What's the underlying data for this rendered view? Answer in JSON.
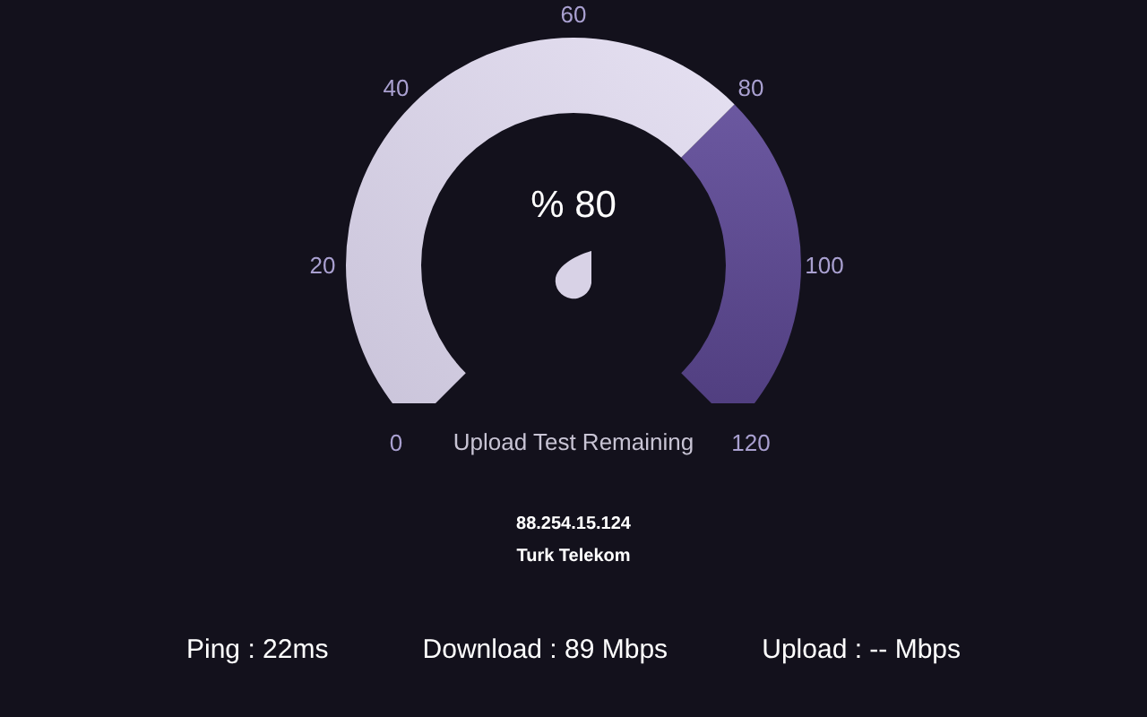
{
  "gauge": {
    "value": "% 80",
    "ticks": [
      "0",
      "20",
      "40",
      "60",
      "80",
      "100",
      "120"
    ]
  },
  "status": "Upload Test Remaining",
  "server": {
    "ip": "88.254.15.124",
    "isp": "Turk Telekom"
  },
  "stats": [
    "Ping : 22ms",
    "Download : 89 Mbps",
    "Upload : -- Mbps"
  ]
}
